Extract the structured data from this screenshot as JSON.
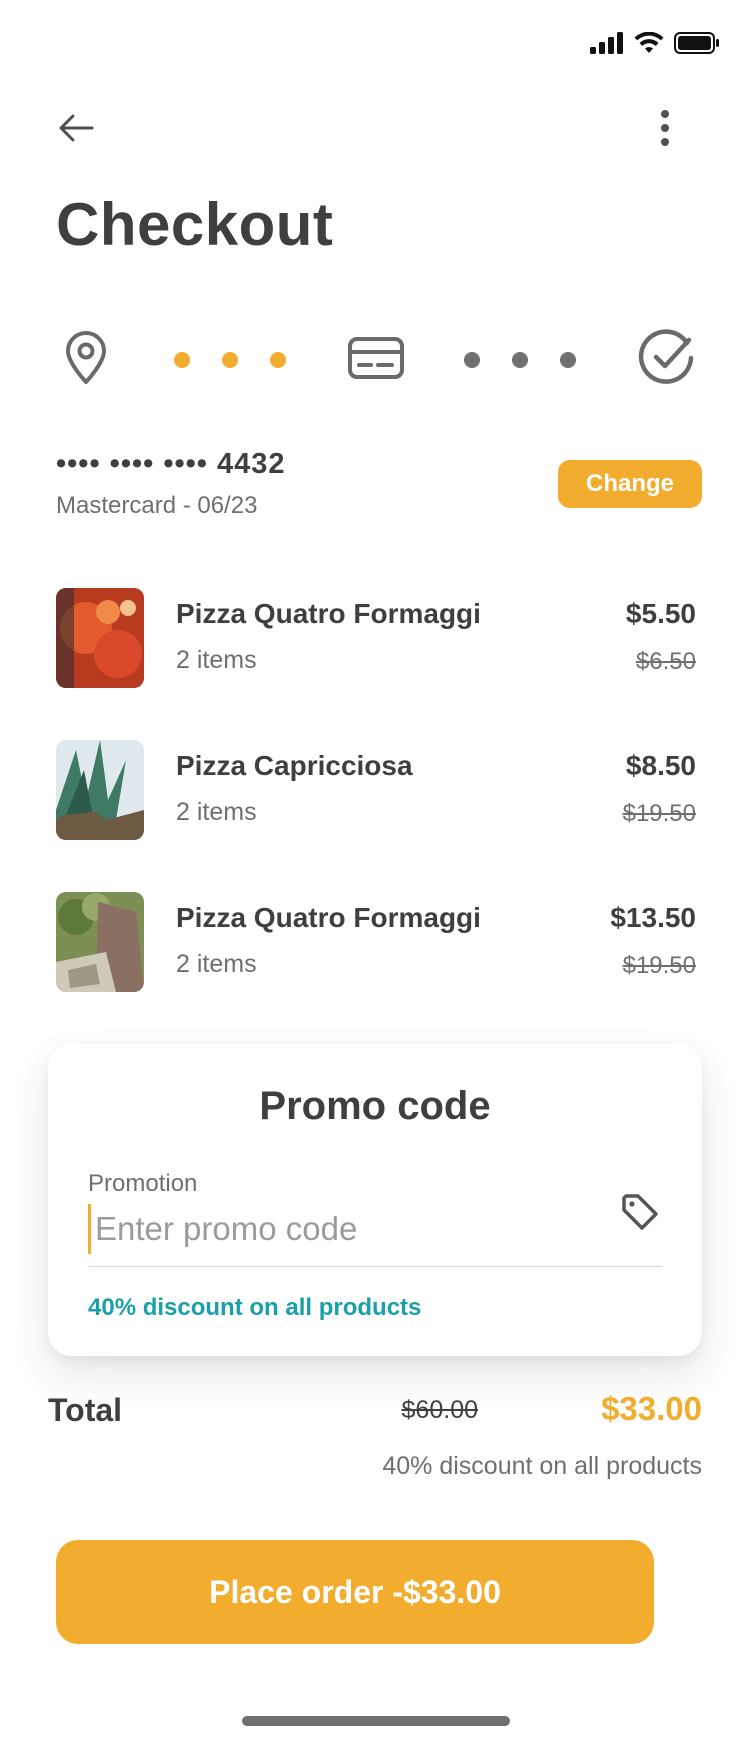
{
  "status_bar": {
    "icons": [
      "signal-icon",
      "wifi-icon",
      "battery-icon"
    ]
  },
  "nav": {
    "back_icon": "arrow-left-icon",
    "more_icon": "more-vertical-icon"
  },
  "title": "Checkout",
  "stepper": {
    "steps": [
      "location-pin-icon",
      "credit-card-icon",
      "check-circle-icon"
    ],
    "active_color": "#F2AD2E",
    "inactive_color": "#707070"
  },
  "payment": {
    "card_number": "•••• •••• •••• 4432",
    "card_meta": "Mastercard - 06/23",
    "change_label": "Change"
  },
  "items": [
    {
      "name": "Pizza Quatro Formaggi",
      "qty": "2 items",
      "price": "$5.50",
      "old_price": "$6.50"
    },
    {
      "name": "Pizza Capricciosa",
      "qty": "2 items",
      "price": "$8.50",
      "old_price": "$19.50"
    },
    {
      "name": "Pizza Quatro Formaggi",
      "qty": "2 items",
      "price": "$13.50",
      "old_price": "$19.50"
    }
  ],
  "promo": {
    "title": "Promo code",
    "label": "Promotion",
    "placeholder": "Enter promo code",
    "hint": "40% discount on all products",
    "icon": "tag-icon"
  },
  "total": {
    "label": "Total",
    "old": "$60.00",
    "new": "$33.00",
    "note": "40% discount on all products"
  },
  "place_order_label": "Place order -$33.00",
  "colors": {
    "accent": "#F2AD2E",
    "teal": "#1AA0A8",
    "text": "#3F3F3F"
  }
}
